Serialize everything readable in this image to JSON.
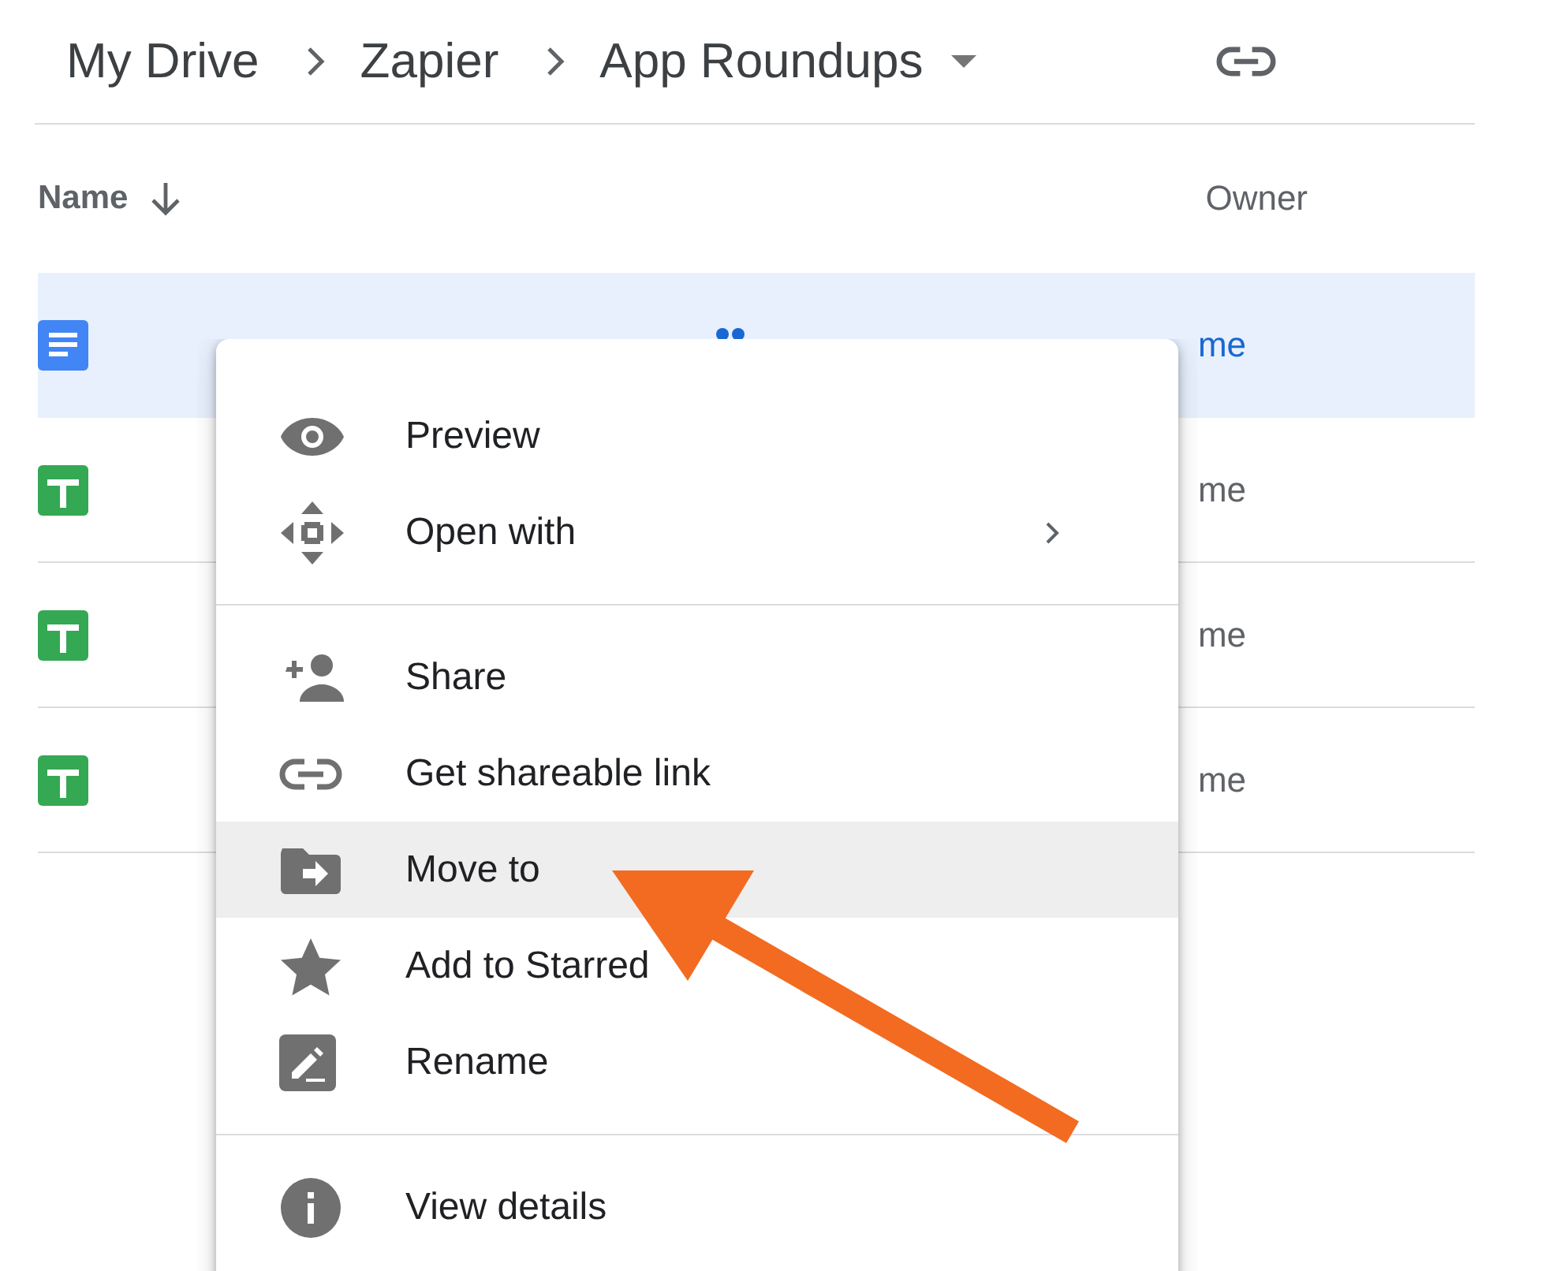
{
  "breadcrumb": {
    "items": [
      {
        "label": "My Drive"
      },
      {
        "label": "Zapier"
      },
      {
        "label": "App Roundups",
        "dropdown": true
      }
    ]
  },
  "columns": {
    "name": "Name",
    "owner": "Owner"
  },
  "rows": [
    {
      "kind": "doc",
      "shared": true,
      "owner": "me",
      "selected": true
    },
    {
      "kind": "sheet",
      "owner": "me",
      "selected": false
    },
    {
      "kind": "sheet",
      "owner": "me",
      "selected": false
    },
    {
      "kind": "sheet",
      "owner": "me",
      "selected": false
    }
  ],
  "menu": {
    "sections": [
      [
        {
          "kind": "eye",
          "label": "Preview",
          "submenu": false,
          "selected": false
        },
        {
          "kind": "move",
          "label": "Open with",
          "submenu": true,
          "selected": false
        }
      ],
      [
        {
          "kind": "person-add",
          "label": "Share",
          "submenu": false,
          "selected": false
        },
        {
          "kind": "link",
          "label": "Get shareable link",
          "submenu": false,
          "selected": false
        },
        {
          "kind": "folder-move",
          "label": "Move to",
          "submenu": false,
          "selected": true
        },
        {
          "kind": "star",
          "label": "Add to Starred",
          "submenu": false,
          "selected": false
        },
        {
          "kind": "rename",
          "label": "Rename",
          "submenu": false,
          "selected": false
        }
      ],
      [
        {
          "kind": "info",
          "label": "View details",
          "submenu": false,
          "selected": false
        }
      ]
    ]
  }
}
